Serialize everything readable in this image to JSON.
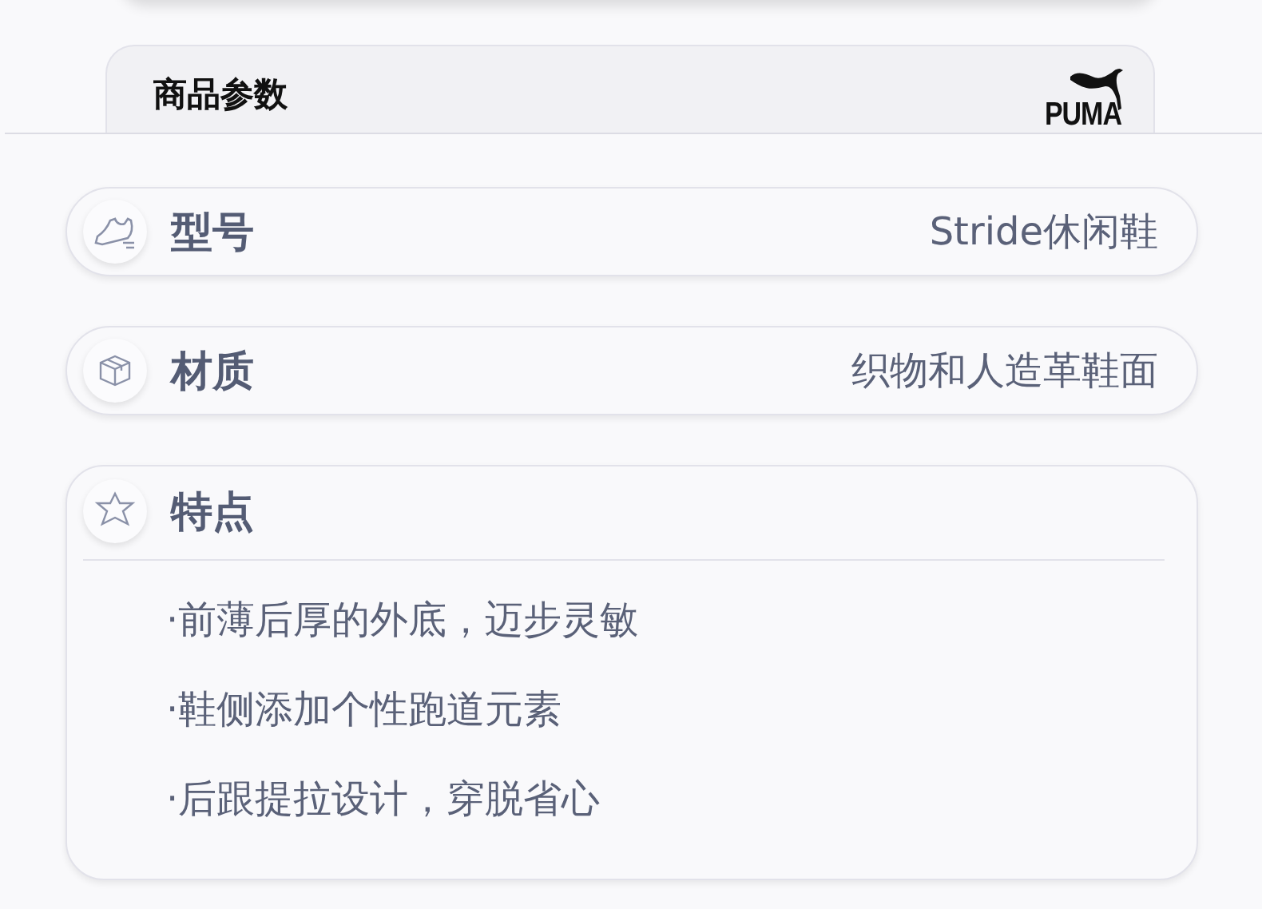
{
  "header": {
    "title": "商品参数",
    "brand_logo": "PUMA"
  },
  "params": [
    {
      "kind": "value",
      "label": "型号",
      "value": "Stride休闲鞋"
    },
    {
      "kind": "value",
      "label": "材质",
      "value": "织物和人造革鞋面"
    },
    {
      "kind": "list",
      "label": "特点",
      "items": [
        "·前薄后厚的外底，迈步灵敏",
        "·鞋侧添加个性跑道元素",
        "·后跟提拉设计，穿脱省心"
      ]
    }
  ]
}
